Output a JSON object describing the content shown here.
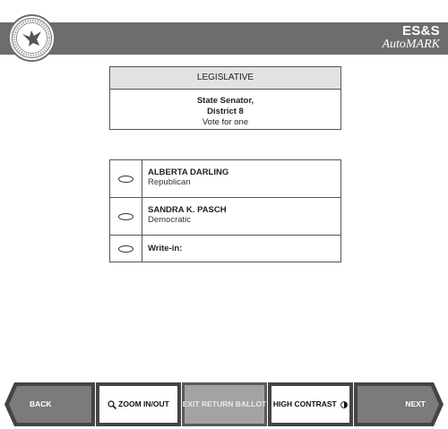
{
  "header": {
    "brand_line1": "ES&S",
    "brand_line2": "AutoMARK",
    "bar_color": "#6d6d6d"
  },
  "contest": {
    "category": "LEGISLATIVE",
    "office_line1": "State Senator,",
    "office_line2": "District 8",
    "instruction": "Vote for one"
  },
  "candidates": [
    {
      "name": "ALBERTA DARLING",
      "party": "Republican"
    },
    {
      "name": "SANDRA K. PASCH",
      "party": "Democratic"
    },
    {
      "name": "Write-in:",
      "party": ""
    }
  ],
  "nav": {
    "back": "BACK",
    "zoom": "ZOOM IN/OUT",
    "exit": "EXIT RETURN BALLOT",
    "contrast": "HIGH CONTRAST",
    "next": "NEXT",
    "zoom_icon": "magnifier-icon",
    "contrast_icon": "half-circle-icon"
  }
}
